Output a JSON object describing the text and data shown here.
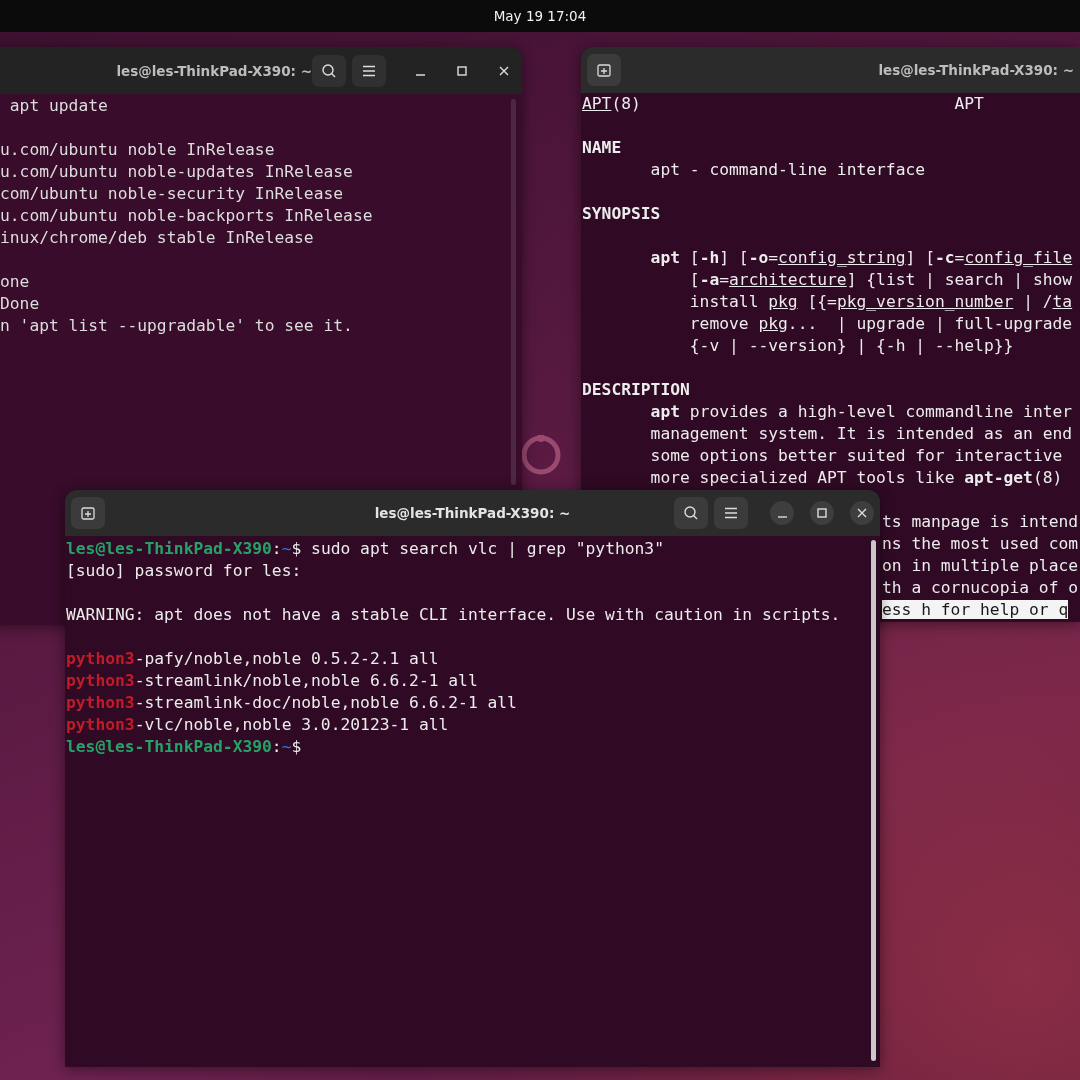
{
  "top_bar": {
    "clock": "May 19 17:04"
  },
  "left_terminal": {
    "title": "les@les-ThinkPad-X390: ~",
    "blocks": [
      [
        {
          "kind": "tail",
          "text": "apt update"
        }
      ],
      [
        {
          "kind": "plain",
          "text": "u.com/ubuntu noble InRelease"
        },
        {
          "kind": "plain",
          "text": "u.com/ubuntu noble-updates InRelease"
        },
        {
          "kind": "plain",
          "text": "com/ubuntu noble-security InRelease"
        },
        {
          "kind": "plain",
          "text": "u.com/ubuntu noble-backports InRelease"
        },
        {
          "kind": "plain",
          "text": "inux/chrome/deb stable InRelease"
        }
      ],
      [
        {
          "kind": "plain",
          "text": "one"
        },
        {
          "kind": "plain",
          "text": "Done"
        },
        {
          "kind": "plain",
          "text": "n 'apt list --upgradable' to see it."
        }
      ]
    ]
  },
  "man_terminal": {
    "title": "les@les-ThinkPad-X390: ~",
    "blocks": [
      [
        {
          "kind": "title",
          "left": "*APT*(8)",
          "center": "APT"
        }
      ],
      [
        {
          "kind": "heading",
          "text": "NAME"
        },
        {
          "kind": "body",
          "text": "apt - command-line interface"
        }
      ],
      [
        {
          "kind": "heading",
          "text": "SYNOPSIS"
        }
      ],
      [
        {
          "kind": "body",
          "text": "**apt** [**-h**] [**-o**=*config_string*] [**-c**=*config_file*"
        },
        {
          "kind": "continued",
          "text": "[**-a**=*architecture*] {list | search | show"
        },
        {
          "kind": "continued",
          "text": "install *pkg* [{=*pkg_version_number* | /*ta*"
        },
        {
          "kind": "continued",
          "text": "remove *pkg*...  | upgrade | full-upgrade"
        },
        {
          "kind": "continued",
          "text": "{-v | --version} | {-h | --help}}"
        }
      ],
      [
        {
          "kind": "heading",
          "text": "DESCRIPTION"
        },
        {
          "kind": "body",
          "text": "**apt** provides a high-level commandline inter"
        },
        {
          "kind": "body",
          "text": "management system. It is intended as an end"
        },
        {
          "kind": "body",
          "text": "some options better suited for interactive"
        },
        {
          "kind": "body",
          "text": "more specialized APT tools like **apt-get**(8)"
        }
      ],
      [
        {
          "kind": "covered",
          "text": "ts manpage is intend"
        },
        {
          "kind": "covered",
          "text": "ns the most used com"
        },
        {
          "kind": "covered",
          "text": "on in multiple place"
        },
        {
          "kind": "covered",
          "text": "th a cornucopia of o"
        },
        {
          "kind": "status",
          "text": "ess h for help or q"
        }
      ]
    ]
  },
  "active_terminal": {
    "title": "les@les-ThinkPad-X390: ~",
    "blocks": [
      [
        {
          "kind": "prompt",
          "user": "les@les-ThinkPad-X390",
          "sep": ":",
          "path": "~",
          "symbol": "$",
          "command": "sudo apt search vlc | grep \"python3\""
        },
        {
          "kind": "plain",
          "text": "[sudo] password for les:"
        }
      ],
      [
        {
          "kind": "plain",
          "text": "WARNING: apt does not have a stable CLI interface. Use with caution in scripts."
        }
      ],
      [
        {
          "kind": "match",
          "match": "python3",
          "rest": "-pafy/noble,noble 0.5.2-2.1 all"
        },
        {
          "kind": "match",
          "match": "python3",
          "rest": "-streamlink/noble,noble 6.6.2-1 all"
        },
        {
          "kind": "match",
          "match": "python3",
          "rest": "-streamlink-doc/noble,noble 6.6.2-1 all"
        },
        {
          "kind": "match",
          "match": "python3",
          "rest": "-vlc/noble,noble 3.0.20123-1 all"
        },
        {
          "kind": "prompt",
          "user": "les@les-ThinkPad-X390",
          "sep": ":",
          "path": "~",
          "symbol": "$"
        }
      ]
    ]
  }
}
